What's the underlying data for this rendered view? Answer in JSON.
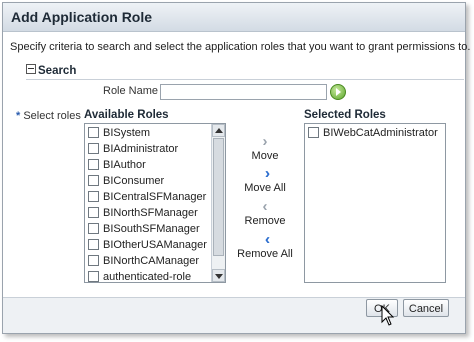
{
  "dialog": {
    "title": "Add Application Role",
    "instructions": "Specify criteria to search and select the application roles that you want to grant permissions to."
  },
  "search": {
    "header": "Search",
    "role_name_label": "Role Name",
    "role_name_value": ""
  },
  "select": {
    "required_marker": "*",
    "label": "Select roles",
    "available_header": "Available Roles",
    "selected_header": "Selected Roles",
    "available_roles": [
      "BISystem",
      "BIAdministrator",
      "BIAuthor",
      "BIConsumer",
      "BICentralSFManager",
      "BINorthSFManager",
      "BISouthSFManager",
      "BIOtherUSAManager",
      "BINorthCAManager",
      "authenticated-role"
    ],
    "selected_roles": [
      "BIWebCatAdministrator"
    ]
  },
  "shuttle": {
    "move": "Move",
    "move_all": "Move All",
    "remove": "Remove",
    "remove_all": "Remove All"
  },
  "footer": {
    "ok": "OK",
    "cancel": "Cancel"
  },
  "icons": {
    "move": "chevron-right-icon",
    "move_all": "double-chevron-right-icon",
    "remove": "chevron-left-icon",
    "remove_all": "double-chevron-left-icon",
    "go": "go-arrow-icon",
    "collapse": "collapse-minus-icon"
  }
}
